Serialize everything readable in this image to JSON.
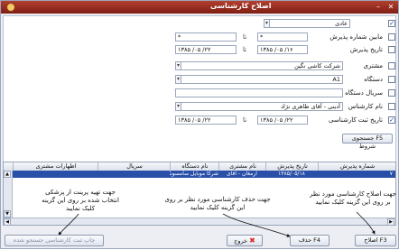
{
  "window": {
    "title": "اصلاح کارشناسی",
    "minimize": "–",
    "close": "✕"
  },
  "filters": {
    "top_value": "عادی",
    "reception_number": {
      "label": "مابین شماره پذیرش",
      "from": "*",
      "to": "*",
      "sep": "تا"
    },
    "reception_date": {
      "label": "تاریخ پذیرش",
      "from": "۱۳۸۵ /۰۵ /۱۶",
      "to": "۱۳۸۵ /۰۵ /۲۲",
      "sep": "تا"
    },
    "customer": {
      "label": "مشتری",
      "value": "شرکت کاشی نگین"
    },
    "device": {
      "label": "دستگاه",
      "value": "A1"
    },
    "serial": {
      "label": "سریال دستگاه",
      "value": ""
    },
    "expert": {
      "label": "نام کارشناس",
      "value": "آدینی - آقای طاهری نژاد"
    },
    "expert_date": {
      "label": "تاریخ ثبت کارشناسی",
      "from": "۱۳۸۵ /۰۵ /۲۲",
      "to": "۱۳۸۵ /۰۵ /۲۲",
      "sep": "تا"
    },
    "search_button": "F5  جستجوی شروط"
  },
  "grid": {
    "columns": [
      "شماره پذیرش",
      "تاریخ پذیرش",
      "نام مشتری",
      "نام دستگاه",
      "سریال",
      "اظهارات مشتری"
    ],
    "rows": [
      {
        "number": "۷",
        "date": "۱۳۸۵/۰۵/۱۸",
        "customer": "ارمغان - آقای",
        "device": "شرکا موبایل سامسونگ",
        "serial": "",
        "statement": ""
      }
    ]
  },
  "annotations": {
    "print_note": "جهت تهیه پرینت از پزشکی انتخاب شده بر روی این گزینه کلیک نمایید",
    "delete_note": "جهت حذف کارشناسی مورد نظر بر روی این گزینه کلیک نمایید",
    "edit_note": "جهت اصلاح کارشناسی مورد نظر بر روی این گزینه کلیک نمایید"
  },
  "buttons": {
    "edit": "F3 اصلاح",
    "delete": "F4 حذف",
    "exit": "خروج",
    "print": "چاپ ثبت کارشناسی جستجو شده"
  }
}
